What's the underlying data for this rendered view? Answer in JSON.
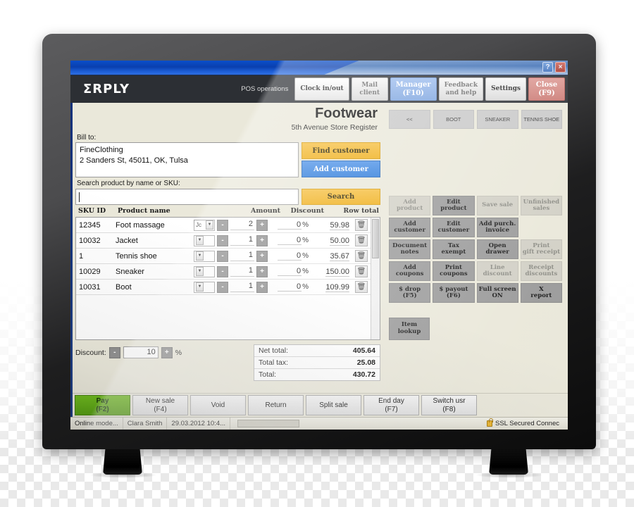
{
  "window": {
    "help_button": "?",
    "close_button": "×"
  },
  "header": {
    "logo": "ΣRPLY",
    "pos_operations_label": "POS operations",
    "nav": [
      {
        "label": "Clock in/out",
        "state": "active"
      },
      {
        "label": "Mail\nclient",
        "state": "muted"
      },
      {
        "label": "Manager\n(F10)",
        "state": "manager"
      },
      {
        "label": "Feedback\nand help",
        "state": "muted"
      },
      {
        "label": "Settings",
        "state": "normal"
      },
      {
        "label": "Close\n(F9)",
        "state": "close"
      }
    ]
  },
  "main": {
    "page_title": "Footwear",
    "page_subtitle": "5th Avenue Store Register",
    "bill_to_label": "Bill to:",
    "bill_to_value": "FineClothing\n2 Sanders St, 45011, OK, Tulsa",
    "find_customer_label": "Find customer",
    "add_customer_label": "Add customer",
    "search_label": "Search product by name or SKU:",
    "search_value": "",
    "search_button_label": "Search",
    "table": {
      "columns": [
        "SKU ID",
        "Product name",
        "Amount",
        "Discount",
        "Row total"
      ],
      "rows": [
        {
          "sku": "12345",
          "name": "Foot massage",
          "variant": "Jc",
          "amount": "2",
          "discount": "0",
          "pct": "%",
          "total": "59.98"
        },
        {
          "sku": "10032",
          "name": "Jacket",
          "variant": "",
          "amount": "1",
          "discount": "0",
          "pct": "%",
          "total": "50.00"
        },
        {
          "sku": "1",
          "name": "Tennis shoe",
          "variant": "",
          "amount": "1",
          "discount": "0",
          "pct": "%",
          "total": "35.67"
        },
        {
          "sku": "10029",
          "name": "Sneaker",
          "variant": "",
          "amount": "1",
          "discount": "0",
          "pct": "%",
          "total": "150.00"
        },
        {
          "sku": "10031",
          "name": "Boot",
          "variant": "",
          "amount": "1",
          "discount": "0",
          "pct": "%",
          "total": "109.99"
        }
      ],
      "minus_label": "-",
      "plus_label": "+",
      "delete_icon": "🗑"
    },
    "discount_label": "Discount:",
    "discount_value": "10",
    "discount_unit": "%",
    "discount_minus": "-",
    "discount_plus": "+",
    "totals": [
      {
        "label": "Net total:",
        "value": "405.64"
      },
      {
        "label": "Total tax:",
        "value": "25.08"
      },
      {
        "label": "Total:",
        "value": "430.72"
      }
    ]
  },
  "right_panel": {
    "category_tabs": [
      {
        "label": "<<"
      },
      {
        "label": "BOOT"
      },
      {
        "label": "SNEAKER"
      },
      {
        "label": "TENNIS SHOE"
      }
    ],
    "action_grid": [
      {
        "label": "Add product",
        "state": "dim"
      },
      {
        "label": "Edit\nproduct",
        "state": "normal"
      },
      {
        "label": "Save sale",
        "state": "dim"
      },
      {
        "label": "Unfinished\nsales",
        "state": "dim"
      },
      {
        "label": "Add\ncustomer",
        "state": "normal"
      },
      {
        "label": "Edit\ncustomer",
        "state": "normal"
      },
      {
        "label": "Add purch.\ninvoice",
        "state": "normal"
      },
      {
        "label": "",
        "state": "blank"
      },
      {
        "label": "Document\nnotes",
        "state": "normal"
      },
      {
        "label": "Tax\nexempt",
        "state": "normal"
      },
      {
        "label": "Open\ndrawer",
        "state": "normal"
      },
      {
        "label": "Print\ngift receipt",
        "state": "dim"
      },
      {
        "label": "Add\ncoupons",
        "state": "normal"
      },
      {
        "label": "Print\ncoupons",
        "state": "normal"
      },
      {
        "label": "Line\ndiscount",
        "state": "dim"
      },
      {
        "label": "Receipt\ndiscounts",
        "state": "dim"
      },
      {
        "label": "$ drop\n(F5)",
        "state": "normal"
      },
      {
        "label": "$ payout\n(F6)",
        "state": "normal"
      },
      {
        "label": "Full screen\nON",
        "state": "normal"
      },
      {
        "label": "X\nreport",
        "state": "normal"
      }
    ],
    "item_lookup_label": "Item\nlookup"
  },
  "action_bar": [
    {
      "label": "Pay\n(F2)",
      "state": "pay"
    },
    {
      "label": "New sale\n(F4)",
      "state": "normal"
    },
    {
      "label": "Void",
      "state": "normal"
    },
    {
      "label": "Return",
      "state": "normal"
    },
    {
      "label": "Split sale",
      "state": "normal"
    },
    {
      "label": "End day\n(F7)",
      "state": "normal"
    },
    {
      "label": "Switch usr\n(F8)",
      "state": "normal"
    }
  ],
  "status_bar": {
    "mode": "Online mode...",
    "user": "Clara Smith",
    "datetime": "29.03.2012 10:4...",
    "ssl": "SSL Secured Connec"
  },
  "colors": {
    "header_bg": "#2c2f34",
    "accent_orange": "#efae17",
    "accent_blue": "#2b7ada",
    "manager_blue": "#8eb3e8",
    "close_red": "#d88a8a",
    "pay_green": "#55a80b",
    "panel_beige": "#eae8da",
    "titlebar_blue": "#0a3fae"
  }
}
